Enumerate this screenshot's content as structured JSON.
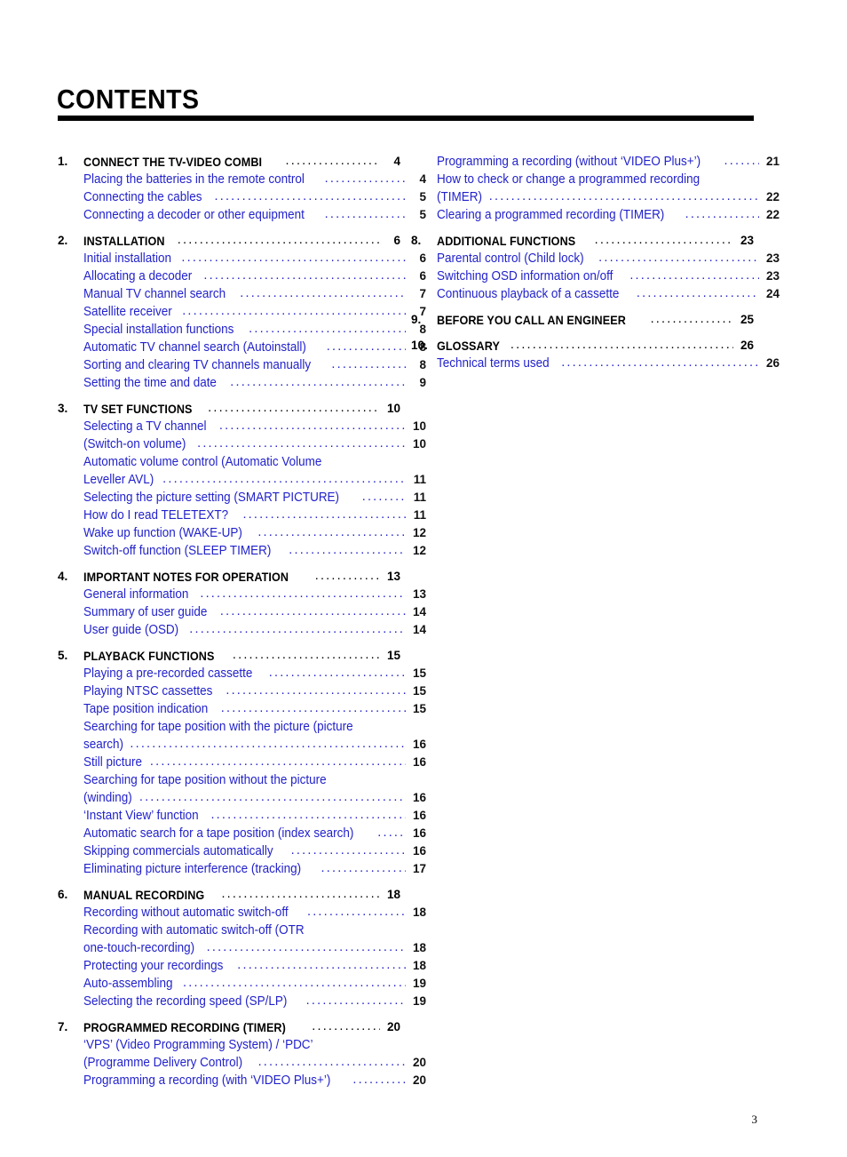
{
  "page": {
    "title": "CONTENTS",
    "folio": "3",
    "accent_color": "#2222cc",
    "rule_color": "#000000",
    "leader_char": "."
  },
  "left_column": [
    {
      "number": "1.",
      "title": "CONNECT THE TV-VIDEO COMBI",
      "page": "4",
      "entries": [
        {
          "label": "Placing the batteries in the remote control",
          "page": "4"
        },
        {
          "label": "Connecting the cables",
          "page": "5"
        },
        {
          "label": "Connecting a decoder or other equipment",
          "page": "5"
        }
      ]
    },
    {
      "number": "2.",
      "title": "INSTALLATION",
      "page": "6",
      "entries": [
        {
          "label": "Initial installation",
          "page": "6"
        },
        {
          "label": "Allocating a decoder",
          "page": "6"
        },
        {
          "label": "Manual TV channel search",
          "page": "7"
        },
        {
          "label": "Satellite receiver",
          "page": "7"
        },
        {
          "label": "Special installation functions",
          "page": "8"
        },
        {
          "label": "Automatic TV channel search (Autoinstall)",
          "page": "8"
        },
        {
          "label": "Sorting and clearing TV channels manually",
          "page": "8"
        },
        {
          "label": "Setting the time and date",
          "page": "9"
        }
      ]
    },
    {
      "number": "3.",
      "title": "TV SET FUNCTIONS",
      "page": "10",
      "entries": [
        {
          "label": "Selecting a TV channel",
          "page": "10"
        },
        {
          "label": "(Switch-on volume)",
          "page": "10"
        },
        {
          "label": "Automatic volume control (Automatic Volume",
          "page": "",
          "wrap_first": true
        },
        {
          "label": "Leveller AVL)",
          "page": "11"
        },
        {
          "label": "Selecting the picture setting (SMART PICTURE)",
          "page": "11"
        },
        {
          "label": "How do I read TELETEXT?",
          "page": "11"
        },
        {
          "label": "Wake up function (WAKE-UP)",
          "page": "12"
        },
        {
          "label": "Switch-off function (SLEEP TIMER)",
          "page": "12"
        }
      ]
    },
    {
      "number": "4.",
      "title": "IMPORTANT NOTES FOR OPERATION",
      "page": "13",
      "entries": [
        {
          "label": "General information",
          "page": "13"
        },
        {
          "label": "Summary of user guide",
          "page": "14"
        },
        {
          "label": "User guide (OSD)",
          "page": "14"
        }
      ]
    },
    {
      "number": "5.",
      "title": "PLAYBACK FUNCTIONS",
      "page": "15",
      "entries": [
        {
          "label": "Playing a pre-recorded cassette",
          "page": "15"
        },
        {
          "label": "Playing NTSC cassettes",
          "page": "15"
        },
        {
          "label": "Tape position indication",
          "page": "15"
        },
        {
          "label": "Searching for tape position with the picture (picture",
          "page": "",
          "wrap_first": true
        },
        {
          "label": "search)",
          "page": "16"
        },
        {
          "label": "Still picture",
          "page": "16"
        },
        {
          "label": "Searching for tape position without the picture",
          "page": "",
          "wrap_first": true
        },
        {
          "label": "(winding)",
          "page": "16"
        },
        {
          "label": "‘Instant View’ function",
          "page": "16"
        },
        {
          "label": "Automatic search for a tape position (index search)",
          "page": "16"
        },
        {
          "label": "Skipping commercials automatically",
          "page": "16"
        },
        {
          "label": "Eliminating picture interference (tracking)",
          "page": "17"
        }
      ]
    },
    {
      "number": "6.",
      "title": "MANUAL RECORDING",
      "page": "18",
      "entries": [
        {
          "label": "Recording without automatic switch-off",
          "page": "18"
        },
        {
          "label": "Recording with automatic switch-off (OTR",
          "page": "",
          "wrap_first": true
        },
        {
          "label": "one-touch-recording)",
          "page": "18"
        },
        {
          "label": "Protecting your recordings",
          "page": "18"
        },
        {
          "label": "Auto-assembling",
          "page": "19"
        },
        {
          "label": "Selecting the recording speed (SP/LP)",
          "page": "19"
        }
      ]
    },
    {
      "number": "7.",
      "title": "PROGRAMMED RECORDING (TIMER)",
      "page": "20",
      "entries": [
        {
          "label": "‘VPS’ (Video Programming System) / ‘PDC’",
          "page": "",
          "wrap_first": true
        },
        {
          "label": "(Programme Delivery Control)",
          "page": "20"
        },
        {
          "label": "Programming a recording (with ‘VIDEO Plus+’)",
          "page": "20"
        }
      ]
    }
  ],
  "right_column": [
    {
      "number": "",
      "title": "",
      "page": "",
      "continuation": true,
      "entries": [
        {
          "label": "Programming a recording (without ‘VIDEO Plus+’)",
          "page": "21"
        },
        {
          "label": "How to check or change a programmed recording",
          "page": "",
          "wrap_first": true
        },
        {
          "label": "(TIMER)",
          "page": "22"
        },
        {
          "label": "Clearing a programmed recording (TIMER)",
          "page": "22"
        }
      ]
    },
    {
      "number": "8.",
      "title": "ADDITIONAL FUNCTIONS",
      "page": "23",
      "entries": [
        {
          "label": "Parental control (Child lock)",
          "page": "23"
        },
        {
          "label": "Switching OSD information on/off",
          "page": "23"
        },
        {
          "label": "Continuous playback of a cassette",
          "page": "24"
        }
      ]
    },
    {
      "number": "9.",
      "title": "BEFORE YOU CALL AN ENGINEER",
      "page": "25",
      "entries": []
    },
    {
      "number": "10.",
      "title": "GLOSSARY",
      "page": "26",
      "entries": [
        {
          "label": "Technical terms used",
          "page": "26"
        }
      ]
    }
  ]
}
